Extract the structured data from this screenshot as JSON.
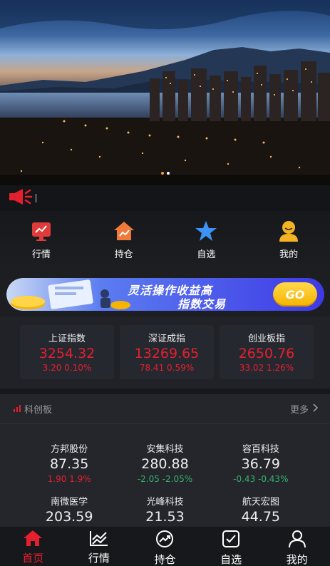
{
  "banner": {
    "dots": 2,
    "active_dot": 0
  },
  "quicknav": [
    {
      "label": "行情",
      "icon": "market-chart-icon",
      "color": "#e03b3b"
    },
    {
      "label": "持仓",
      "icon": "holdings-house-icon",
      "color": "#f07a3b"
    },
    {
      "label": "自选",
      "icon": "star-icon",
      "color": "#3d93f5"
    },
    {
      "label": "我的",
      "icon": "user-icon",
      "color": "#f4b324"
    }
  ],
  "promo": {
    "line1": "灵活操作收益高",
    "line2": "指数交易",
    "button": "GO"
  },
  "indices": [
    {
      "name": "上证指数",
      "value": "3254.32",
      "change": "3.20 0.10%"
    },
    {
      "name": "深证成指",
      "value": "13269.65",
      "change": "78.41 0.59%"
    },
    {
      "name": "创业板指",
      "value": "2650.76",
      "change": "33.02 1.26%"
    }
  ],
  "star": {
    "title": "科创板",
    "more": "更多",
    "stocks": [
      {
        "name": "方邦股份",
        "price": "87.35",
        "change": "1.90 1.9%",
        "dir": "up"
      },
      {
        "name": "安集科技",
        "price": "280.88",
        "change": "-2.05 -2.05%",
        "dir": "down"
      },
      {
        "name": "容百科技",
        "price": "36.79",
        "change": "-0.43 -0.43%",
        "dir": "down"
      },
      {
        "name": "南微医学",
        "price": "203.59",
        "change": "",
        "dir": "up"
      },
      {
        "name": "光峰科技",
        "price": "21.53",
        "change": "",
        "dir": "up"
      },
      {
        "name": "航天宏图",
        "price": "44.75",
        "change": "",
        "dir": "up"
      }
    ]
  },
  "tabs": [
    {
      "label": "首页",
      "icon": "home-icon",
      "active": true
    },
    {
      "label": "行情",
      "icon": "trend-chart-icon",
      "active": false
    },
    {
      "label": "持仓",
      "icon": "holdings-gauge-icon",
      "active": false
    },
    {
      "label": "自选",
      "icon": "checkbox-icon",
      "active": false
    },
    {
      "label": "我的",
      "icon": "user-icon",
      "active": false
    }
  ],
  "colors": {
    "up": "#e5202e",
    "down": "#35b26b",
    "accent": "#f2a02d"
  }
}
